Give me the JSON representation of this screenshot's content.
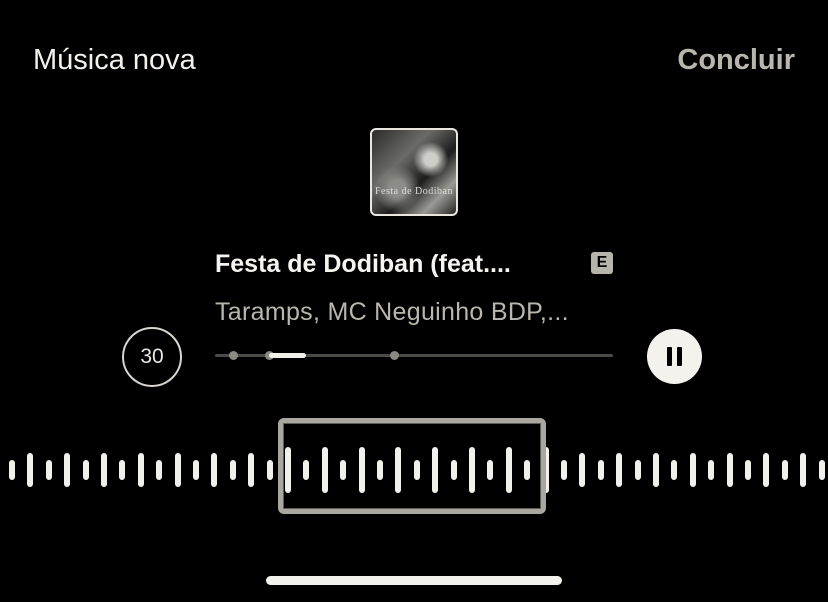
{
  "header": {
    "title": "Música nova",
    "done_label": "Concluir"
  },
  "track": {
    "artwork_text": "Festa de Dodiban",
    "title": "Festa de Dodiban (feat....",
    "explicit_label": "E",
    "artists": "Taramps, MC Neguinho BDP,..."
  },
  "player": {
    "duration_label": "30"
  },
  "colors": {
    "background": "#000000",
    "text_primary": "#f4f2ec",
    "text_secondary": "#b9b6ad",
    "selection_border": "#a9a79f"
  },
  "icons": {
    "pause": "pause-icon"
  }
}
